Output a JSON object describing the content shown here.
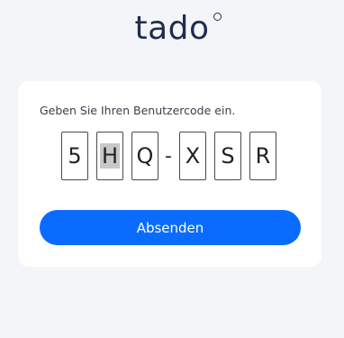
{
  "brand": {
    "logo_text": "tado"
  },
  "form": {
    "prompt": "Geben Sie Ihren Benutzercode ein.",
    "code_chars": [
      "5",
      "H",
      "Q",
      "X",
      "S",
      "R"
    ],
    "separator": "-",
    "selected_index": 1,
    "submit_label": "Absenden"
  },
  "colors": {
    "accent": "#0a6cff",
    "brand_text": "#1e2d4f",
    "page_background": "#f4f5f8",
    "card_background": "#ffffff",
    "selection_highlight": "#c8c8c8"
  }
}
